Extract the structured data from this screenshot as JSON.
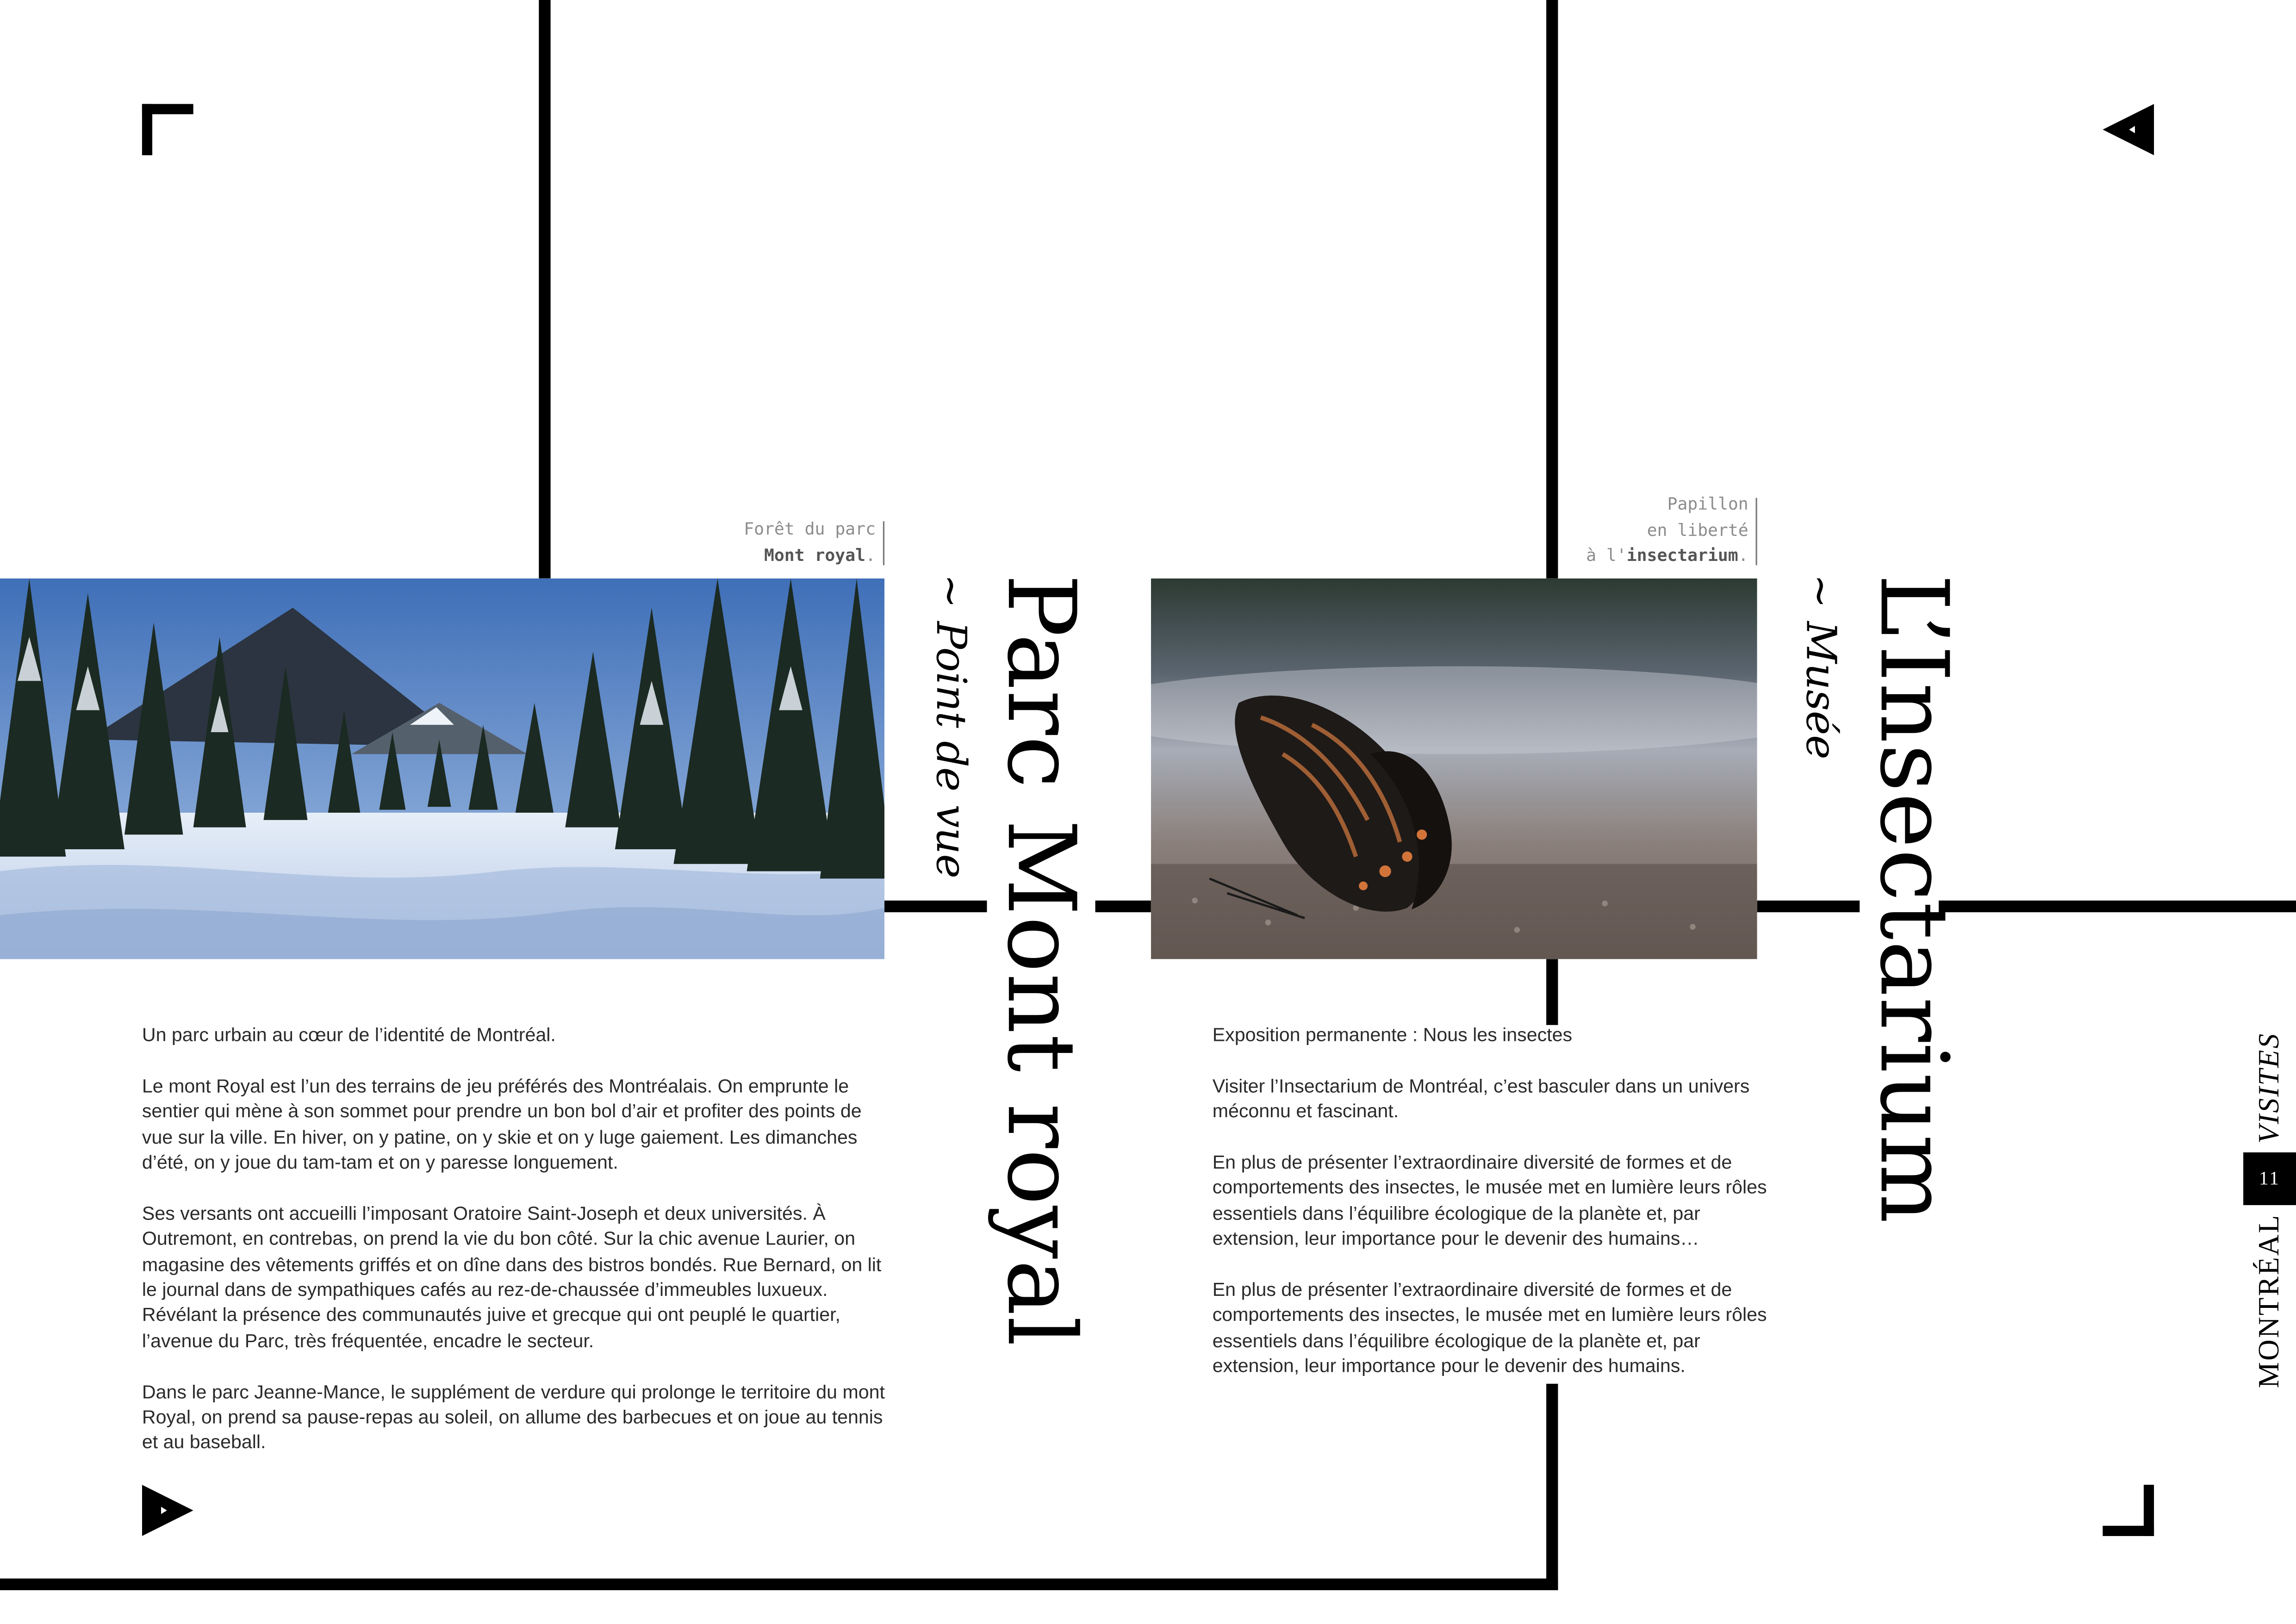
{
  "left_page": {
    "caption": {
      "line1": "Forêt du parc",
      "line2_bold": "Mont royal",
      "line2_tail": "."
    },
    "title": "Parc Mont royal",
    "subtitle": "~ Point de vue",
    "paragraphs": [
      "Un parc urbain au cœur de l’identité de Montréal.",
      "Le mont Royal est l’un des terrains de jeu préférés des Montréalais. On emprunte le sentier qui mène à son sommet pour prendre un bon bol d’air et profiter des points de vue sur la ville. En hiver, on y patine, on y skie et on y luge gaiement. Les dimanches d’été, on y joue du tam-tam et on y paresse longuement.",
      "Ses versants ont accueilli l’imposant Oratoire Saint-Joseph et deux universités. À Outremont, en contrebas, on prend la vie du bon côté. Sur la chic avenue Laurier, on magasine des vêtements griffés et on dîne dans des bistros bondés. Rue Bernard, on lit le journal dans de sympathiques cafés au rez-de-chaussée d’immeubles luxueux. Révélant la présence des communautés juive et grecque qui ont peuplé le quartier, l’avenue du Parc, très fréquentée, encadre le secteur.",
      "Dans le parc Jeanne-Mance, le supplément de verdure qui prolonge le territoire du mont Royal, on prend sa pause-repas au soleil, on allume des barbecues et on joue au tennis et au baseball."
    ]
  },
  "right_page": {
    "caption": {
      "line1": "Papillon",
      "line2": "en liberté",
      "line3_head": "à l'",
      "line3_bold": "insectarium",
      "line3_tail": "."
    },
    "title": "L’Insectarium",
    "subtitle": "~ Musée",
    "paragraphs": [
      "Exposition permanente : Nous les insectes",
      "Visiter l’Insectarium de Montréal, c’est basculer dans un univers méconnu et fascinant.",
      "En plus de présenter l’extraordinaire diversité de formes et de comportements des insectes, le musée met en lumière leurs rôles essentiels dans l’équilibre écologique de la planète et, par extension, leur importance pour le devenir des humains…",
      "En plus de présenter l’extraordinaire diversité de formes et de comportements des insectes, le musée met en lumière leurs rôles essentiels dans l’équilibre écologique de la planète et, par extension, leur importance pour le devenir des humains."
    ]
  },
  "side_tab": {
    "city": "MONTRÉAL",
    "page_number": "11",
    "section": "VISITES"
  },
  "icons": {
    "corner_top_left": "corner-bracket-icon",
    "corner_bottom_right": "corner-bracket-icon",
    "top_right_marker": "triangle-left-icon",
    "bottom_left_marker": "triangle-right-icon"
  },
  "colors": {
    "ink": "#000000",
    "text": "#2a2a2a",
    "caption": "#8c8c8c"
  }
}
